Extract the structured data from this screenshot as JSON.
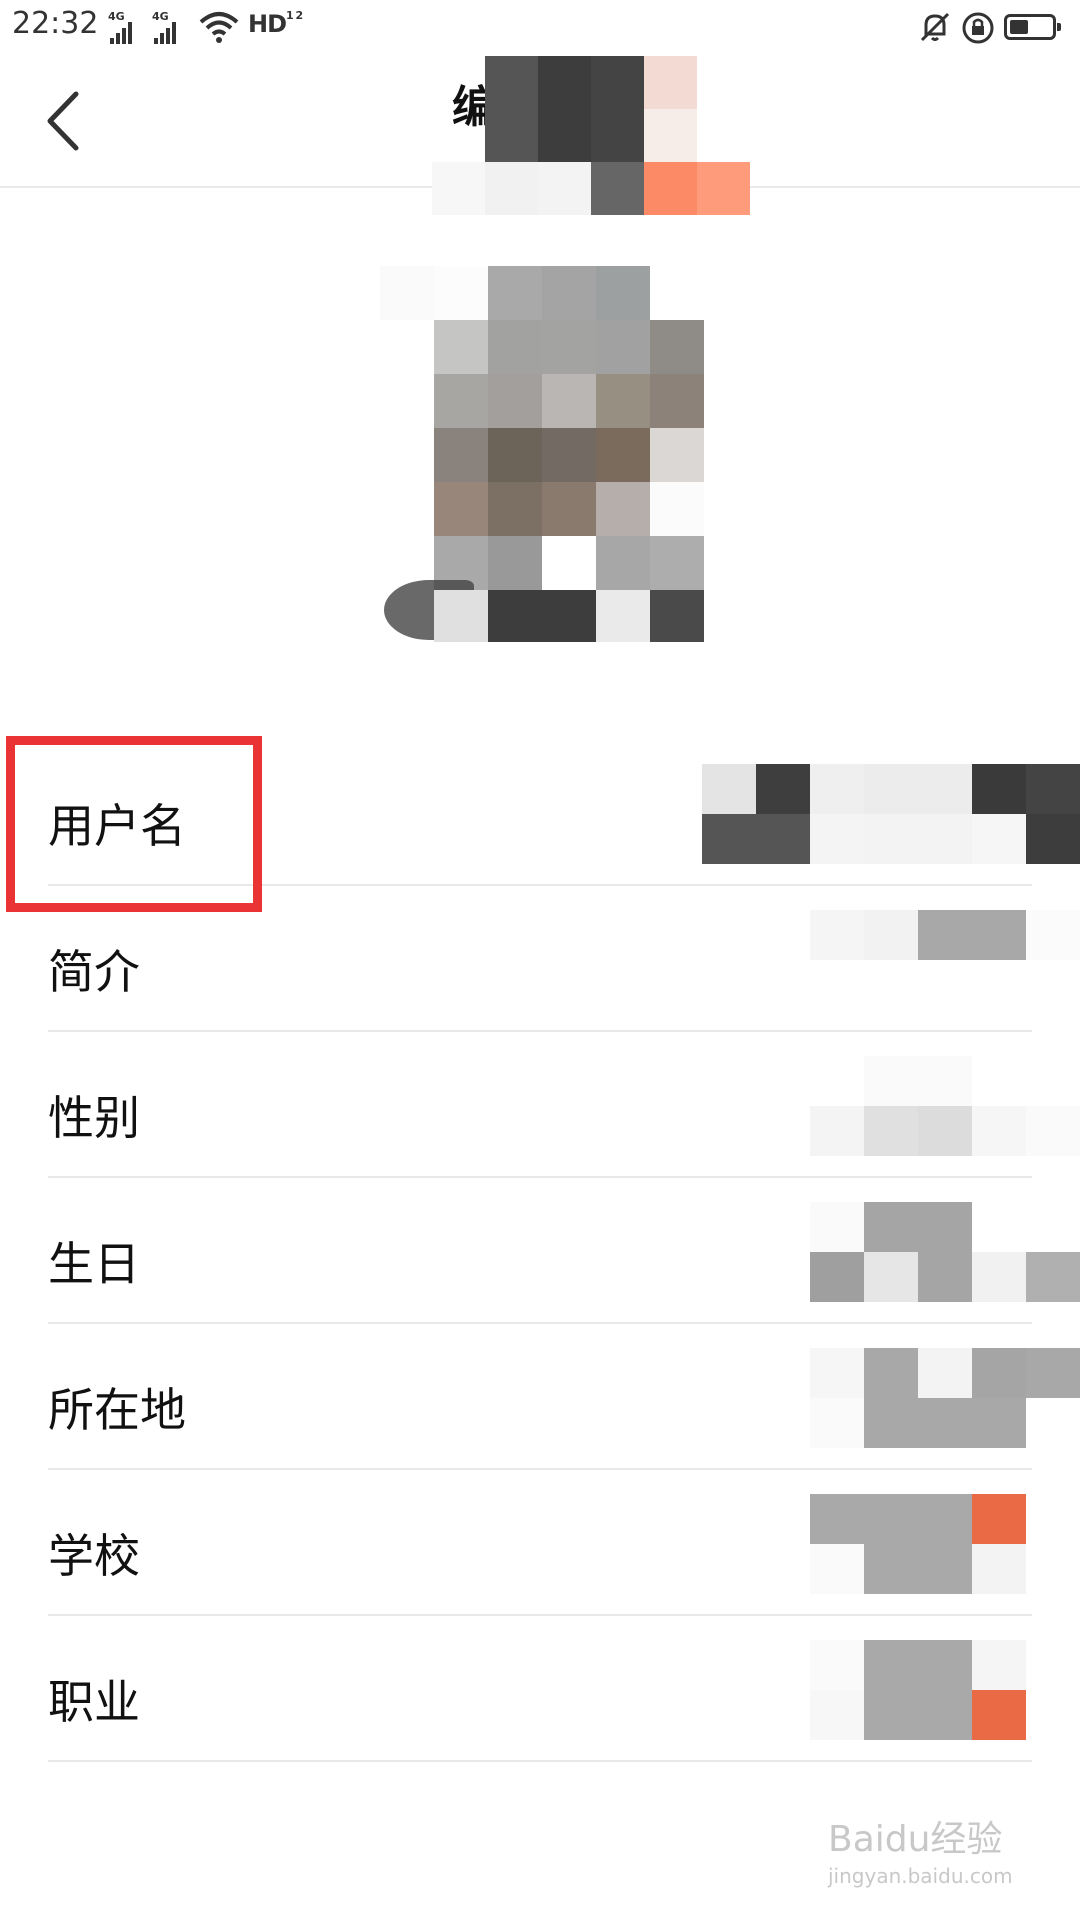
{
  "status_bar": {
    "time": "22:32",
    "network_1": "4G",
    "network_2": "4G",
    "hd_label": "HD",
    "hd_sub": "1 2",
    "battery_level": 0.45,
    "icons": [
      "signal-icon",
      "signal-icon",
      "wifi-icon",
      "hd-icon",
      "mute-icon",
      "rotation-lock-icon",
      "battery-icon"
    ]
  },
  "header": {
    "title": "编辑资料",
    "back_icon": "back-icon"
  },
  "profile": {
    "avatar_icon": "avatar"
  },
  "fields": [
    {
      "label": "用户名"
    },
    {
      "label": "简介"
    },
    {
      "label": "性别"
    },
    {
      "label": "生日"
    },
    {
      "label": "所在地"
    },
    {
      "label": "学校"
    },
    {
      "label": "职业"
    }
  ],
  "watermark": {
    "brand": "Baidu经验",
    "url": "jingyan.baidu.com"
  },
  "colors": {
    "highlight": "#ea3334",
    "divider": "#e8e8e8",
    "accent": "#f06a45"
  }
}
